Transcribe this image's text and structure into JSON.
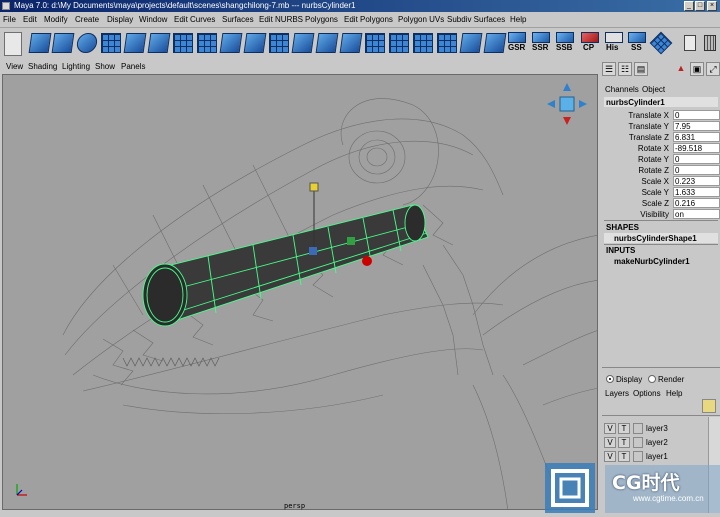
{
  "window": {
    "title": "Maya 7.0: d:\\My Documents\\maya\\projects\\default\\scenes\\shangchilong-7.mb  ---  nurbsCylinder1"
  },
  "menu": [
    "File",
    "Edit",
    "Modify",
    "Create",
    "Display",
    "Window",
    "Edit Curves",
    "Surfaces",
    "Edit NURBS",
    "Polygons",
    "Edit Polygons",
    "Polygon UVs",
    "Subdiv Surfaces",
    "Help"
  ],
  "shelf": {
    "labeled_tools": [
      "GSR",
      "SSR",
      "SSB",
      "CP",
      "His",
      "SS"
    ]
  },
  "viewport": {
    "menu": [
      "View",
      "Shading",
      "Lighting",
      "Show",
      "Panels"
    ],
    "camera_label": "persp"
  },
  "channel_box": {
    "tabs": [
      "Channels",
      "Object"
    ],
    "object_name": "nurbsCylinder1",
    "channels": [
      {
        "label": "Translate X",
        "value": "0"
      },
      {
        "label": "Translate Y",
        "value": "7.95"
      },
      {
        "label": "Translate Z",
        "value": "6.831"
      },
      {
        "label": "Rotate X",
        "value": "-89.518"
      },
      {
        "label": "Rotate Y",
        "value": "0"
      },
      {
        "label": "Rotate Z",
        "value": "0"
      },
      {
        "label": "Scale X",
        "value": "0.223"
      },
      {
        "label": "Scale Y",
        "value": "1.633"
      },
      {
        "label": "Scale Z",
        "value": "0.216"
      },
      {
        "label": "Visibility",
        "value": "on"
      }
    ],
    "shapes_header": "SHAPES",
    "shape_name": "nurbsCylinderShape1",
    "inputs_header": "INPUTS",
    "input_name": "makeNurbCylinder1"
  },
  "layer_editor": {
    "mode_display": "Display",
    "mode_render": "Render",
    "menu": [
      "Layers",
      "Options",
      "Help"
    ],
    "layers": [
      {
        "v": "V",
        "t": "T",
        "name": "layer3"
      },
      {
        "v": "V",
        "t": "T",
        "name": "layer2"
      },
      {
        "v": "V",
        "t": "T",
        "name": "layer1"
      }
    ]
  },
  "watermark": {
    "brand": "CG时代",
    "url": "www.cgtime.com.cn"
  },
  "colors": {
    "viewport_bg": "#a0a0a0",
    "selected_wire": "#44ff88",
    "wireframe": "#6e6e6e",
    "title_bar": "#0a246a"
  }
}
